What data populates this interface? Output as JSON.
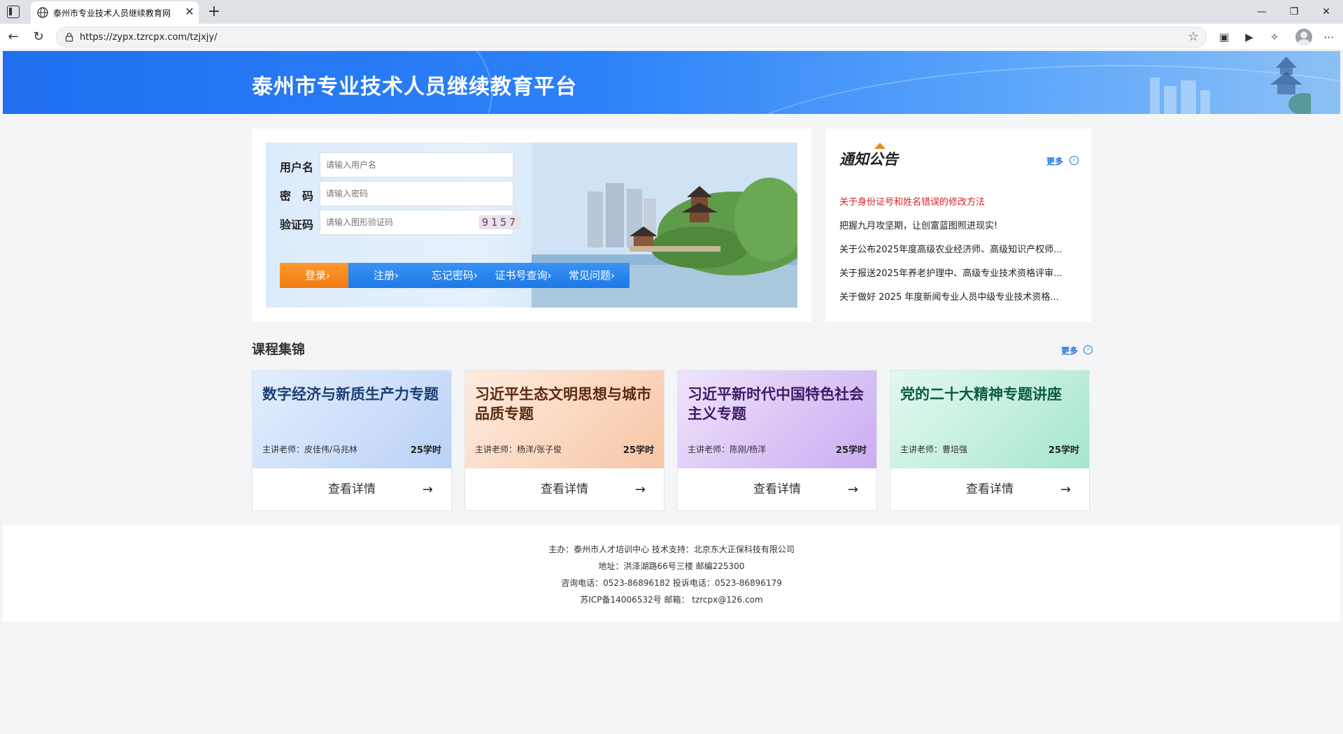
{
  "browser": {
    "tab_title": "泰州市专业技术人员继续教育网",
    "url": "https://zypx.tzrcpx.com/tzjxjy/"
  },
  "banner": {
    "site_title": "泰州市专业技术人员继续教育平台"
  },
  "login": {
    "username_label": "用户名",
    "username_placeholder": "请输入用户名",
    "password_label": "密　码",
    "password_placeholder": "请输入密码",
    "captcha_label": "验证码",
    "captcha_placeholder": "请输入图形验证码",
    "captcha_code": "9157",
    "buttons": {
      "login": "登录›",
      "register": "注册›",
      "forgot": "忘记密码›",
      "cert_query": "证书号查询›",
      "faq": "常见问题›"
    }
  },
  "notice": {
    "title": "通知公告",
    "more": "更多",
    "items": [
      {
        "text": "关于身份证号和姓名错误的修改方法",
        "color": "#e02020"
      },
      {
        "text": "把握九月攻坚期，让创富蓝图照进现实!"
      },
      {
        "text": "关于公布2025年度高级农业经济师、高级知识产权师..."
      },
      {
        "text": "关于报送2025年养老护理中、高级专业技术资格评审..."
      },
      {
        "text": "关于做好 2025 年度新闻专业人员中级专业技术资格..."
      }
    ]
  },
  "courses": {
    "section_title": "课程集锦",
    "more": "更多",
    "items": [
      {
        "title": "数字经济与新质生产力专题",
        "teacher": "主讲老师：皮佳伟/马兆林",
        "hours": "25学时",
        "detail": "查看详情",
        "title_color": "#1d3f73"
      },
      {
        "title": "习近平生态文明思想与城市品质专题",
        "teacher": "主讲老师：杨洋/张子俊",
        "hours": "25学时",
        "detail": "查看详情",
        "title_color": "#5a2a12"
      },
      {
        "title": "习近平新时代中国特色社会主义专题",
        "teacher": "主讲老师：陈刚/杨洋",
        "hours": "25学时",
        "detail": "查看详情",
        "title_color": "#3e1a63"
      },
      {
        "title": "党的二十大精神专题讲座",
        "teacher": "主讲老师：曹培强",
        "hours": "25学时",
        "detail": "查看详情",
        "title_color": "#0d5a47"
      }
    ]
  },
  "footer": {
    "line1": "主办：泰州市人才培训中心 技术支持：北京东大正保科技有限公司",
    "line2": "地址：洪泽湖路66号三楼 邮编225300",
    "line3": "咨询电话：0523-86896182 投诉电话：0523-86896179",
    "line4": "苏ICP备14006532号 邮箱： tzrcpx@126.com"
  }
}
